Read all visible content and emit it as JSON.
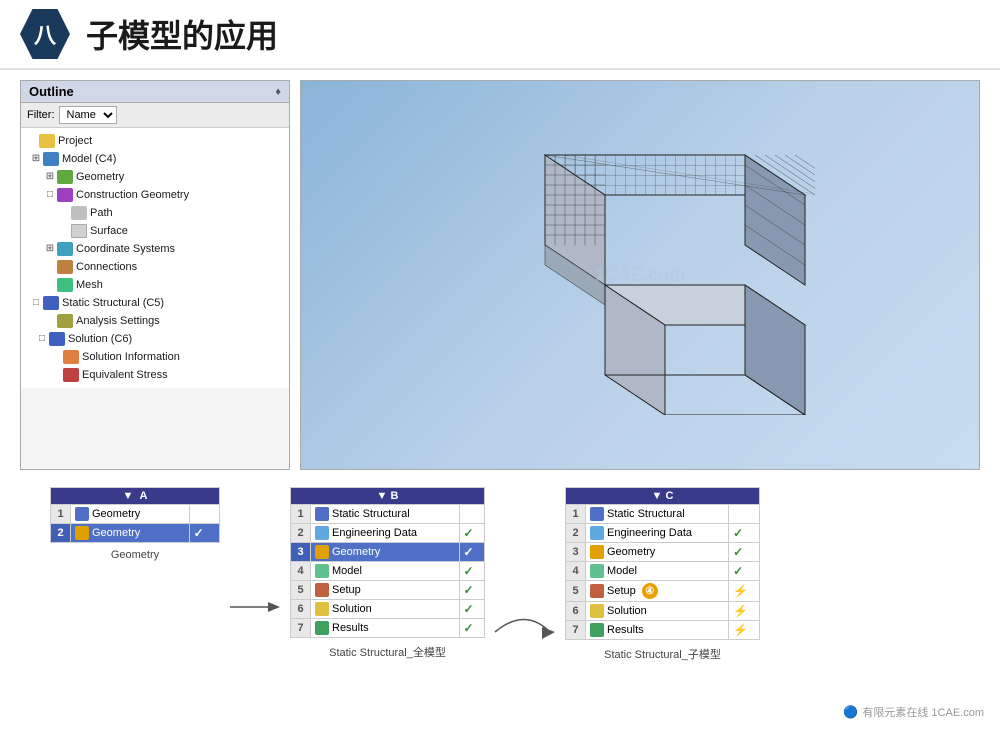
{
  "header": {
    "badge_text": "八",
    "title": "子模型的应用"
  },
  "outline": {
    "panel_title": "Outline",
    "pin_symbol": "♦",
    "filter_label": "Filter:",
    "filter_value": "Name",
    "tree": [
      {
        "id": "project",
        "label": "Project",
        "level": 0,
        "icon": "project",
        "expand": ""
      },
      {
        "id": "model",
        "label": "Model (C4)",
        "level": 1,
        "icon": "model",
        "expand": "⊞"
      },
      {
        "id": "geometry",
        "label": "Geometry",
        "level": 2,
        "icon": "geometry",
        "expand": "⊞"
      },
      {
        "id": "construction",
        "label": "Construction Geometry",
        "level": 2,
        "icon": "construction",
        "expand": "□"
      },
      {
        "id": "path",
        "label": "Path",
        "level": 3,
        "icon": "path",
        "expand": ""
      },
      {
        "id": "surface",
        "label": "Surface",
        "level": 3,
        "icon": "surface",
        "expand": ""
      },
      {
        "id": "coordinate",
        "label": "Coordinate Systems",
        "level": 2,
        "icon": "coordinate",
        "expand": "⊞"
      },
      {
        "id": "connections",
        "label": "Connections",
        "level": 2,
        "icon": "connections",
        "expand": ""
      },
      {
        "id": "mesh",
        "label": "Mesh",
        "level": 2,
        "icon": "mesh",
        "expand": ""
      },
      {
        "id": "static",
        "label": "Static Structural (C5)",
        "level": 1,
        "icon": "static",
        "expand": "□"
      },
      {
        "id": "analysis",
        "label": "Analysis Settings",
        "level": 2,
        "icon": "analysis",
        "expand": ""
      },
      {
        "id": "solution",
        "label": "Solution (C6)",
        "level": 2,
        "icon": "solution",
        "expand": "□"
      },
      {
        "id": "sol_info",
        "label": "Solution Information",
        "level": 3,
        "icon": "sol_info",
        "expand": ""
      },
      {
        "id": "stress",
        "label": "Equivalent Stress",
        "level": 3,
        "icon": "stress",
        "expand": ""
      }
    ]
  },
  "viewport": {
    "watermark": "1CAE.com"
  },
  "workflow": {
    "block_a": {
      "col_letter": "A",
      "rows": [
        {
          "num": "1",
          "label": "Geometry",
          "icon_color": "#5070c8",
          "check": ""
        },
        {
          "num": "2",
          "label": "Geometry",
          "icon_color": "#e0a000",
          "check": "✓",
          "highlighted": true
        }
      ],
      "label": "Geometry"
    },
    "block_b": {
      "col_letter": "B",
      "rows": [
        {
          "num": "1",
          "label": "Static Structural",
          "icon_color": "#5070c8",
          "check": ""
        },
        {
          "num": "2",
          "label": "Engineering Data",
          "icon_color": "#60a8e0",
          "check": "✓"
        },
        {
          "num": "3",
          "label": "Geometry",
          "icon_color": "#e0a000",
          "check": "✓",
          "highlighted": true
        },
        {
          "num": "4",
          "label": "Model",
          "icon_color": "#60c090",
          "check": "✓"
        },
        {
          "num": "5",
          "label": "Setup",
          "icon_color": "#c06040",
          "check": "✓"
        },
        {
          "num": "6",
          "label": "Solution",
          "icon_color": "#e0c040",
          "check": "✓"
        },
        {
          "num": "7",
          "label": "Results",
          "icon_color": "#40a060",
          "check": "✓"
        }
      ],
      "label": "Static Structural_全模型"
    },
    "block_c": {
      "col_letter": "C",
      "rows": [
        {
          "num": "1",
          "label": "Static Structural",
          "icon_color": "#5070c8",
          "check": ""
        },
        {
          "num": "2",
          "label": "Engineering Data",
          "icon_color": "#60a8e0",
          "check": "✓"
        },
        {
          "num": "3",
          "label": "Geometry",
          "icon_color": "#e0a000",
          "check": "✓"
        },
        {
          "num": "4",
          "label": "Model",
          "icon_color": "#60c090",
          "check": "✓"
        },
        {
          "num": "5",
          "label": "Setup",
          "icon_color": "#c06040",
          "check": "",
          "badge": "④",
          "lightning": "⚡"
        },
        {
          "num": "6",
          "label": "Solution",
          "icon_color": "#e0c040",
          "check": "",
          "lightning": "⚡"
        },
        {
          "num": "7",
          "label": "Results",
          "icon_color": "#40a060",
          "check": "",
          "lightning": "⚡"
        }
      ],
      "label": "Static Structural_子模型"
    }
  },
  "watermark": {
    "logo_text": "有限元素在线",
    "site": "1CAE.com"
  }
}
